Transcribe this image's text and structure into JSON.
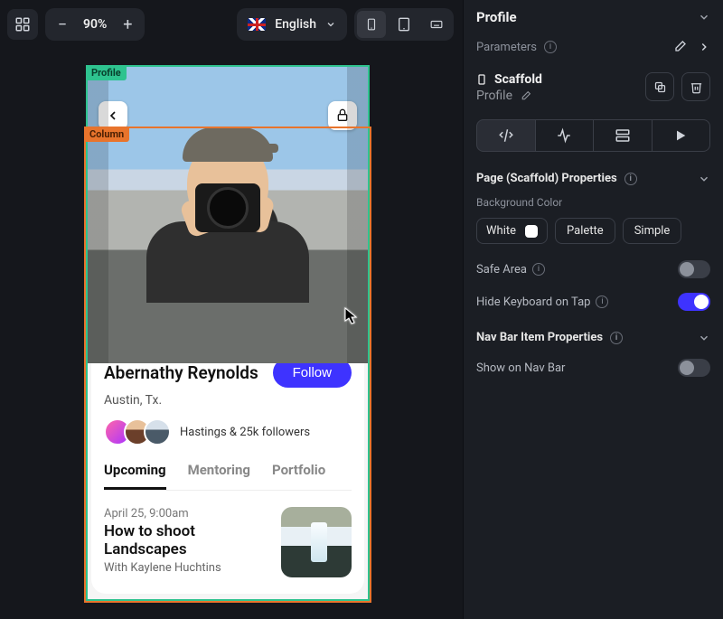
{
  "toolbar": {
    "zoom": "90%",
    "language": "English"
  },
  "selection": {
    "outer_tag": "Profile",
    "inner_tag": "Column"
  },
  "profile": {
    "name": "Abernathy Reynolds",
    "follow_label": "Follow",
    "location": "Austin, Tx.",
    "followers_text": "Hastings & 25k followers",
    "tabs": {
      "upcoming": "Upcoming",
      "mentoring": "Mentoring",
      "portfolio": "Portfolio"
    },
    "event": {
      "date": "April 25, 9:00am",
      "title": "How to shoot Landscapes",
      "with": "With Kaylene Huchtins"
    }
  },
  "panel": {
    "title": "Profile",
    "parameters_label": "Parameters",
    "scaffold_title": "Scaffold",
    "scaffold_sub": "Profile",
    "properties_header": "Page (Scaffold) Properties",
    "bg_label": "Background Color",
    "bg_value": "White",
    "palette_label": "Palette",
    "simple_label": "Simple",
    "safe_area_label": "Safe Area",
    "hide_keyboard_label": "Hide Keyboard on Tap",
    "nav_header": "Nav Bar Item Properties",
    "show_on_nav_label": "Show on Nav Bar"
  }
}
